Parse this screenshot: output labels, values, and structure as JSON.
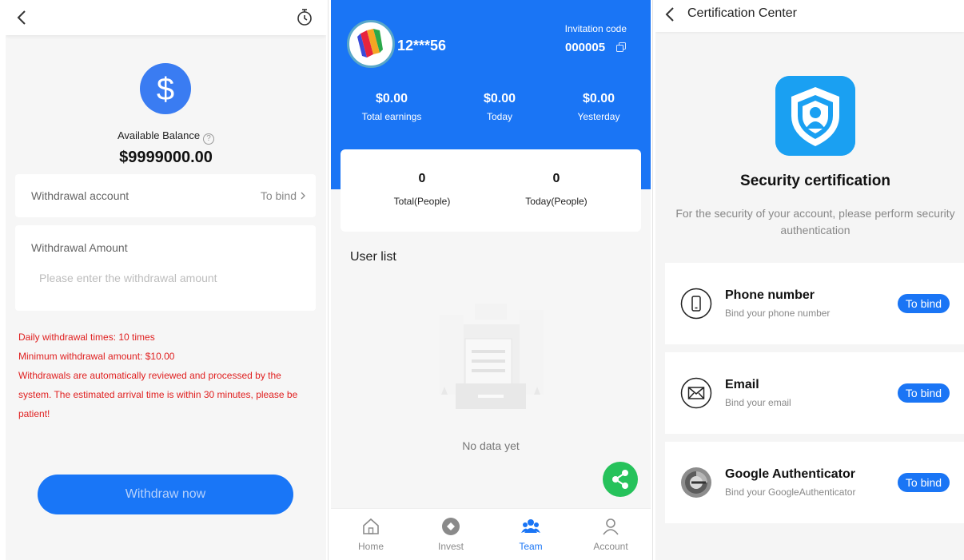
{
  "withdraw": {
    "balance_label": "Available Balance",
    "help": "?",
    "balance_value": "$9999000.00",
    "account_label": "Withdrawal account",
    "account_action": "To bind",
    "amount_label": "Withdrawal Amount",
    "amount_placeholder": "Please enter the withdrawal amount",
    "rules": [
      "Daily withdrawal times: 10 times",
      "Minimum withdrawal amount: $10.00",
      "Withdrawals are automatically reviewed and processed by the system. The estimated arrival time is within 30 minutes, please be patient!"
    ],
    "button_label": "Withdraw now"
  },
  "team": {
    "username": "12***56",
    "invitation_label": "Invitation code",
    "invitation_code": "000005",
    "stats": [
      {
        "value": "$0.00",
        "label": "Total earnings"
      },
      {
        "value": "$0.00",
        "label": "Today"
      },
      {
        "value": "$0.00",
        "label": "Yesterday"
      }
    ],
    "people": [
      {
        "value": "0",
        "label": "Total(People)"
      },
      {
        "value": "0",
        "label": "Today(People)"
      }
    ],
    "user_list_title": "User list",
    "empty_text": "No data yet",
    "tabs": [
      {
        "label": "Home",
        "icon": "home-icon"
      },
      {
        "label": "Invest",
        "icon": "invest-icon"
      },
      {
        "label": "Team",
        "icon": "team-icon",
        "active": true
      },
      {
        "label": "Account",
        "icon": "account-icon"
      }
    ],
    "accent": "#1a75f5"
  },
  "cert": {
    "header_title": "Certification Center",
    "title": "Security certification",
    "description": "For the security of your account, please perform security authentication",
    "items": [
      {
        "title": "Phone number",
        "subtitle": "Bind your phone number",
        "button": "To bind",
        "icon": "phone-icon"
      },
      {
        "title": "Email",
        "subtitle": "Bind your email",
        "button": "To bind",
        "icon": "email-icon"
      },
      {
        "title": "Google Authenticator",
        "subtitle": "Bind your GoogleAuthenticator",
        "button": "To bind",
        "icon": "authenticator-icon"
      }
    ]
  }
}
